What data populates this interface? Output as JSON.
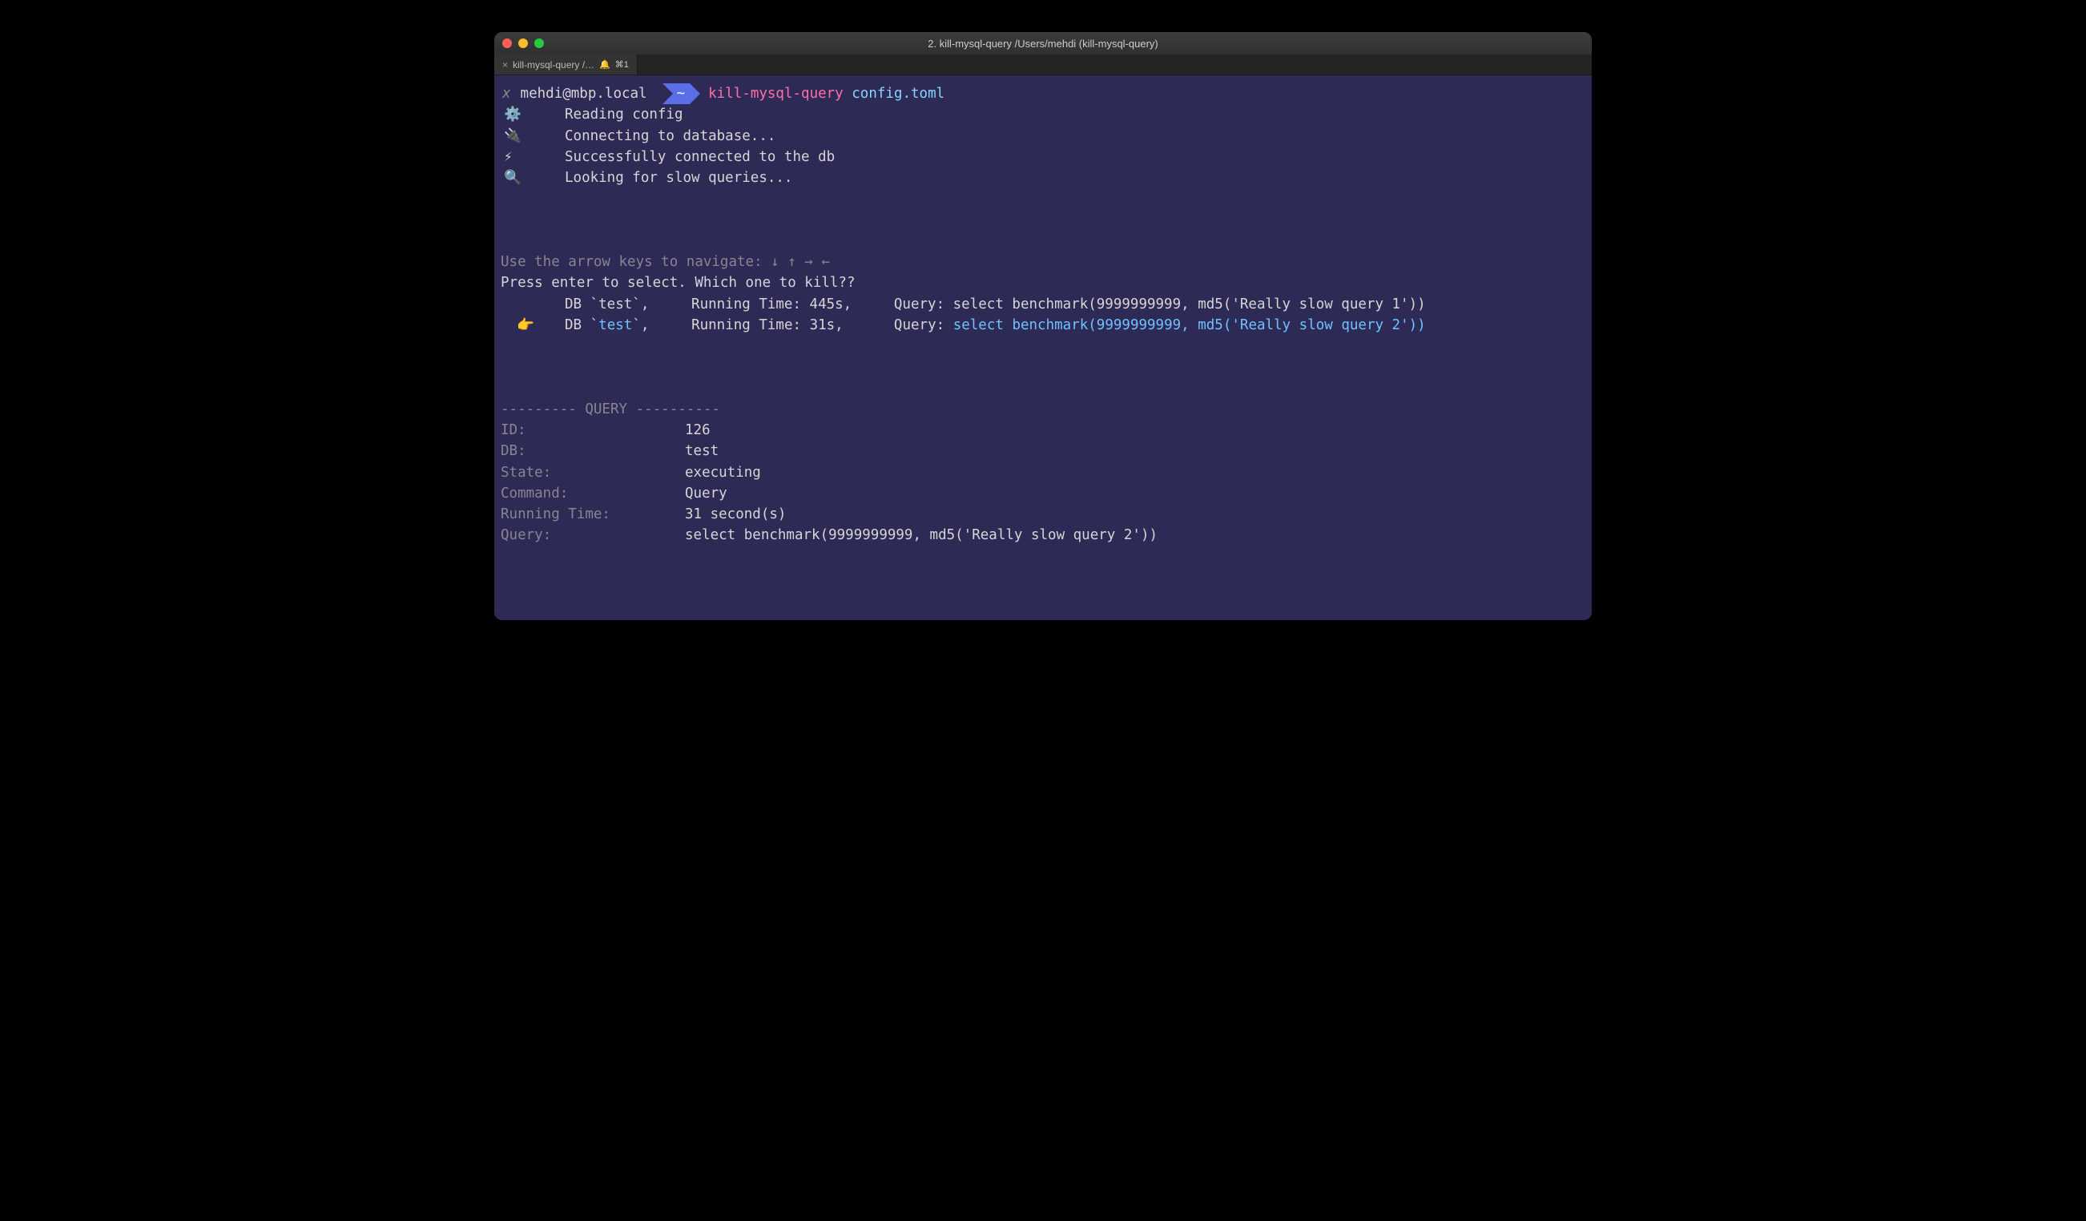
{
  "window": {
    "title": "2. kill-mysql-query  /Users/mehdi (kill-mysql-query)"
  },
  "tab": {
    "label": "kill-mysql-query /…",
    "badge": "⌘1"
  },
  "prompt": {
    "x": "x",
    "host": "mehdi@mbp.local",
    "cwd": "~",
    "command": "kill-mysql-query",
    "arg": "config.toml"
  },
  "status": [
    {
      "icon": "⚙️",
      "text": "Reading config"
    },
    {
      "icon": "🔌",
      "text": "Connecting to database..."
    },
    {
      "icon": "⚡",
      "text": "Successfully connected to the db"
    },
    {
      "icon": "🔍",
      "text": "Looking for slow queries..."
    }
  ],
  "nav_hint": "Use the arrow keys to navigate: ↓ ↑ → ←",
  "select_prompt": "Press enter to select. Which one to kill??",
  "options": [
    {
      "selected": false,
      "pointer": "",
      "text_pre": "DB `test`,     Running Time: 445s,     Query: select benchmark(9999999999, md5('Really slow query 1'))"
    },
    {
      "selected": true,
      "pointer": "👉",
      "db_pre": "DB `",
      "db_name": "test",
      "db_post": "`,     Running Time: 31s,      Query: ",
      "query": "select benchmark(9999999999, md5('Really slow query 2'))"
    }
  ],
  "divider": "--------- QUERY ----------",
  "details": [
    {
      "key": "ID:",
      "val": "126"
    },
    {
      "key": "DB:",
      "val": "test"
    },
    {
      "key": "State:",
      "val": "executing"
    },
    {
      "key": "Command:",
      "val": "Query"
    },
    {
      "key": "Running Time:",
      "val": "31 second(s)"
    },
    {
      "key": "Query:",
      "val": "select benchmark(9999999999, md5('Really slow query 2'))"
    }
  ]
}
